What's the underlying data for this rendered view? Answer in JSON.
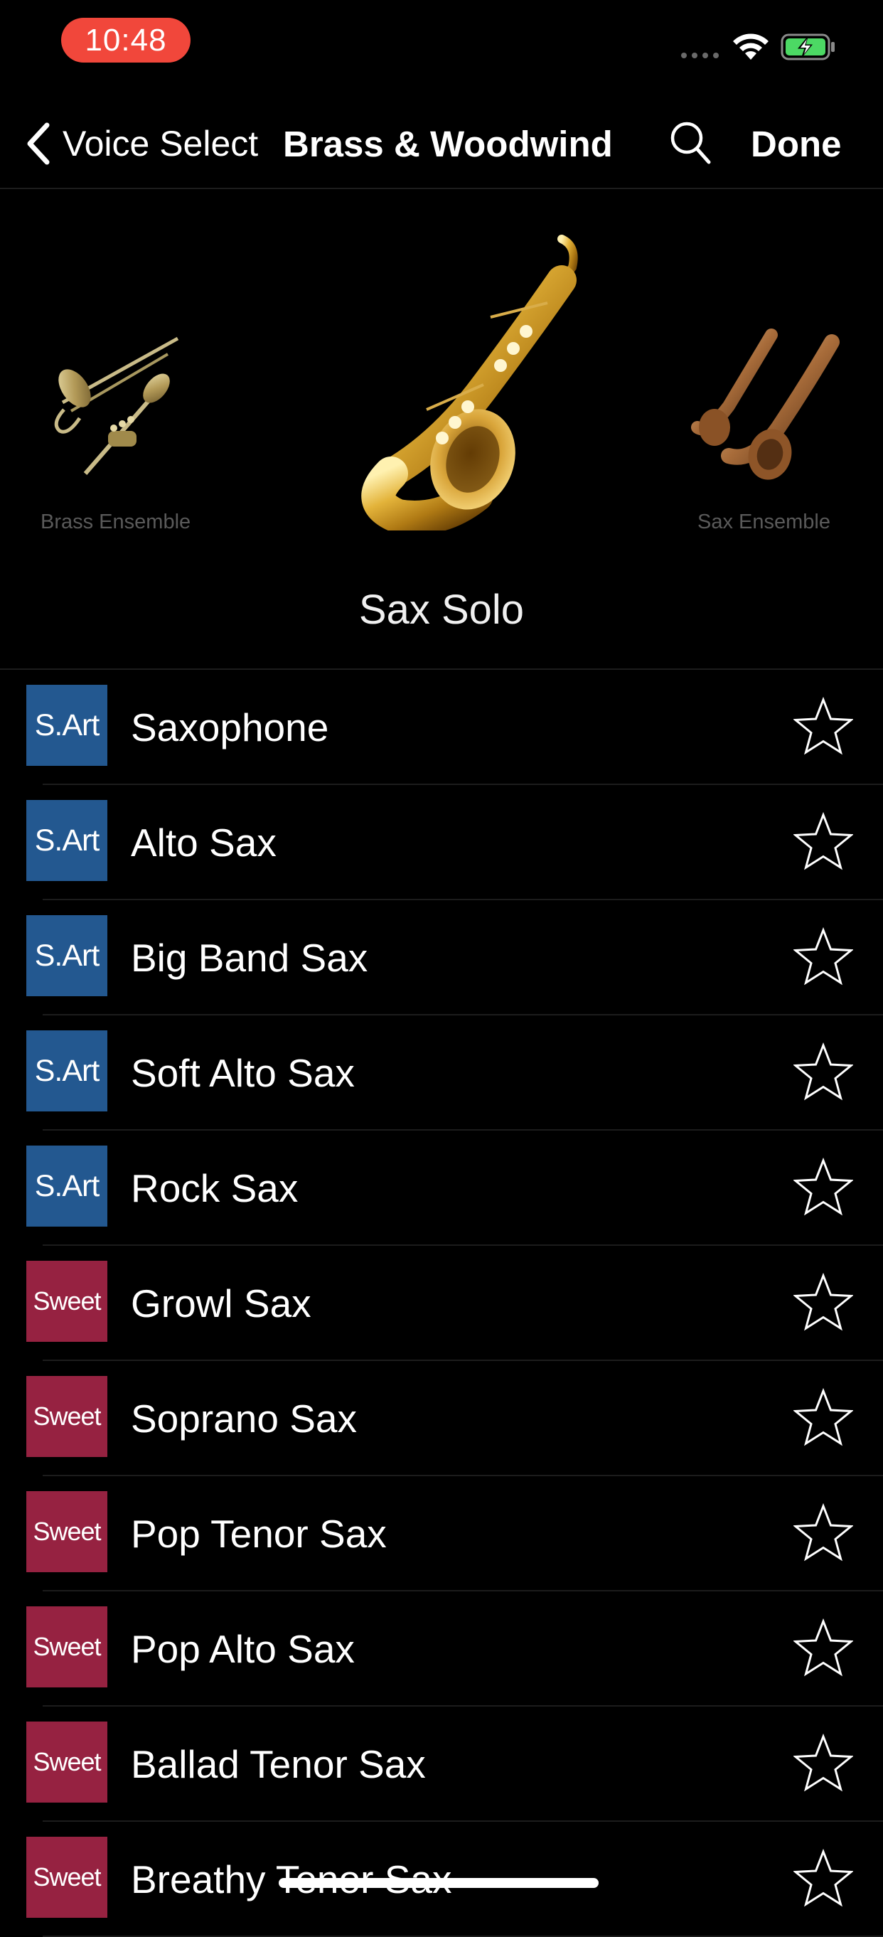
{
  "status_bar": {
    "time": "10:48",
    "time_pill_color": "#f1473b",
    "icons": [
      "signal-dots-icon",
      "wifi-icon",
      "battery-charging-icon"
    ]
  },
  "nav": {
    "back_label": "Voice Select",
    "title": "Brass & Woodwind",
    "search_icon": "search-icon",
    "done_label": "Done"
  },
  "carousel": {
    "items": [
      {
        "caption": "Brass Ensemble",
        "image": "trombone-trumpet-image"
      },
      {
        "caption": "",
        "image": "alto-saxophone-image"
      },
      {
        "caption": "Sax Ensemble",
        "image": "saxophones-image"
      }
    ],
    "selected_title": "Sax Solo"
  },
  "voices": [
    {
      "badge": "S.Art",
      "type": "sart",
      "name": "Saxophone"
    },
    {
      "badge": "S.Art",
      "type": "sart",
      "name": "Alto Sax"
    },
    {
      "badge": "S.Art",
      "type": "sart",
      "name": "Big Band Sax"
    },
    {
      "badge": "S.Art",
      "type": "sart",
      "name": "Soft Alto Sax"
    },
    {
      "badge": "S.Art",
      "type": "sart",
      "name": "Rock Sax"
    },
    {
      "badge": "Sweet",
      "type": "sweet",
      "name": "Growl Sax"
    },
    {
      "badge": "Sweet",
      "type": "sweet",
      "name": "Soprano Sax"
    },
    {
      "badge": "Sweet",
      "type": "sweet",
      "name": "Pop Tenor Sax"
    },
    {
      "badge": "Sweet",
      "type": "sweet",
      "name": "Pop Alto Sax"
    },
    {
      "badge": "Sweet",
      "type": "sweet",
      "name": "Ballad Tenor Sax"
    },
    {
      "badge": "Sweet",
      "type": "sweet",
      "name": "Breathy Tenor Sax"
    }
  ],
  "colors": {
    "background": "#000000",
    "sart_badge": "#235890",
    "sweet_badge": "#962241",
    "caption_gray": "#5a5a5a"
  }
}
